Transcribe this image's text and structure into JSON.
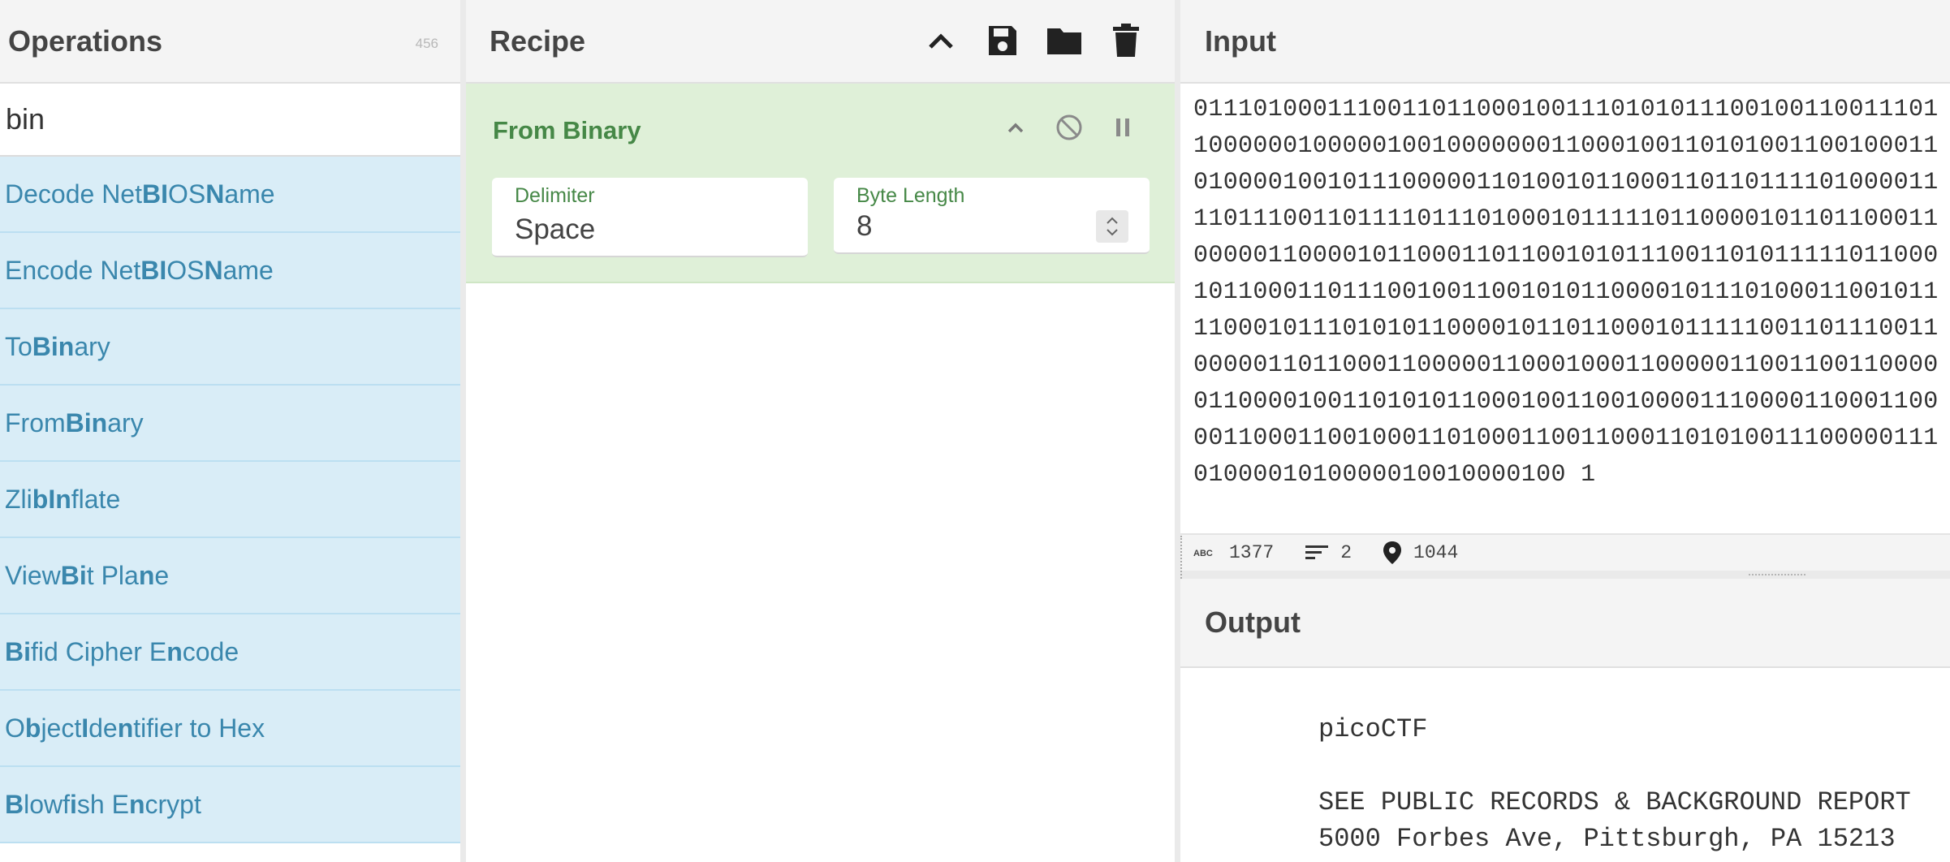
{
  "operations": {
    "title": "Operations",
    "count": "456",
    "search_value": "bin",
    "items": [
      {
        "label": "Decode NetBIOS Name",
        "html": "Decode Net<b>BI</b>OS <b>N</b>ame"
      },
      {
        "label": "Encode NetBIOS Name",
        "html": "Encode Net<b>BI</b>OS <b>N</b>ame"
      },
      {
        "label": "To Binary",
        "html": "To <b>Bin</b>ary"
      },
      {
        "label": "From Binary",
        "html": "From <b>Bin</b>ary"
      },
      {
        "label": "Zlib Inflate",
        "html": "Zli<b>b</b> <b>In</b>flate"
      },
      {
        "label": "View Bit Plane",
        "html": "View <b>Bi</b>t Pla<b>n</b>e"
      },
      {
        "label": "Bifid Cipher Encode",
        "html": "<b>Bi</b>fid Cipher E<b>n</b>code"
      },
      {
        "label": "Object Identifier to Hex",
        "html": "O<b>b</b>ject <b>I</b>de<b>n</b>tifier to Hex"
      },
      {
        "label": "Blowfish Encrypt",
        "html": "<b>B</b>lowf<b>i</b>sh E<b>n</b>crypt"
      }
    ]
  },
  "recipe": {
    "title": "Recipe",
    "controls": {
      "collapse_icon": "chevron-up-icon",
      "save_icon": "save-icon",
      "load_icon": "folder-icon",
      "clear_icon": "trash-icon"
    },
    "operation": {
      "title": "From Binary",
      "args": {
        "delimiter_label": "Delimiter",
        "delimiter_value": "Space",
        "byte_length_label": "Byte Length",
        "byte_length_value": "8"
      }
    }
  },
  "input": {
    "title": "Input",
    "lines": [
      "01110100011100110110001001110101011100100110011101",
      "10000001000001001000000011000100110101001100100011",
      "01000010010111000001101001011000110110111101000011",
      "11011100110111101110100010111110110000101101100011",
      "00000110000101100011011001010111001101011111011000",
      "10110001101110010011001010110000101110100011001011",
      "11000101110101011000010110110001011111001101110011",
      "00000110110001100000110001000110000011001100110000",
      "01100001001101010110001001100100001110000110001100",
      "00110001100100011010001100110001101010011100000111",
      "0100001010000010010000100 1"
    ],
    "stats": {
      "length": "1377",
      "lines": "2",
      "position": "1044"
    }
  },
  "output": {
    "title": "Output",
    "lines": [
      "picoCTF",
      "",
      "SEE PUBLIC RECORDS & BACKGROUND REPORT",
      "5000 Forbes Ave, Pittsburgh, PA 15213"
    ]
  },
  "colors": {
    "op_item_bg": "#d9edf7",
    "op_item_text": "#3a87ad",
    "recipe_card_bg": "#dff0d8",
    "recipe_card_text": "#468847",
    "header_bg": "#f4f4f4"
  }
}
